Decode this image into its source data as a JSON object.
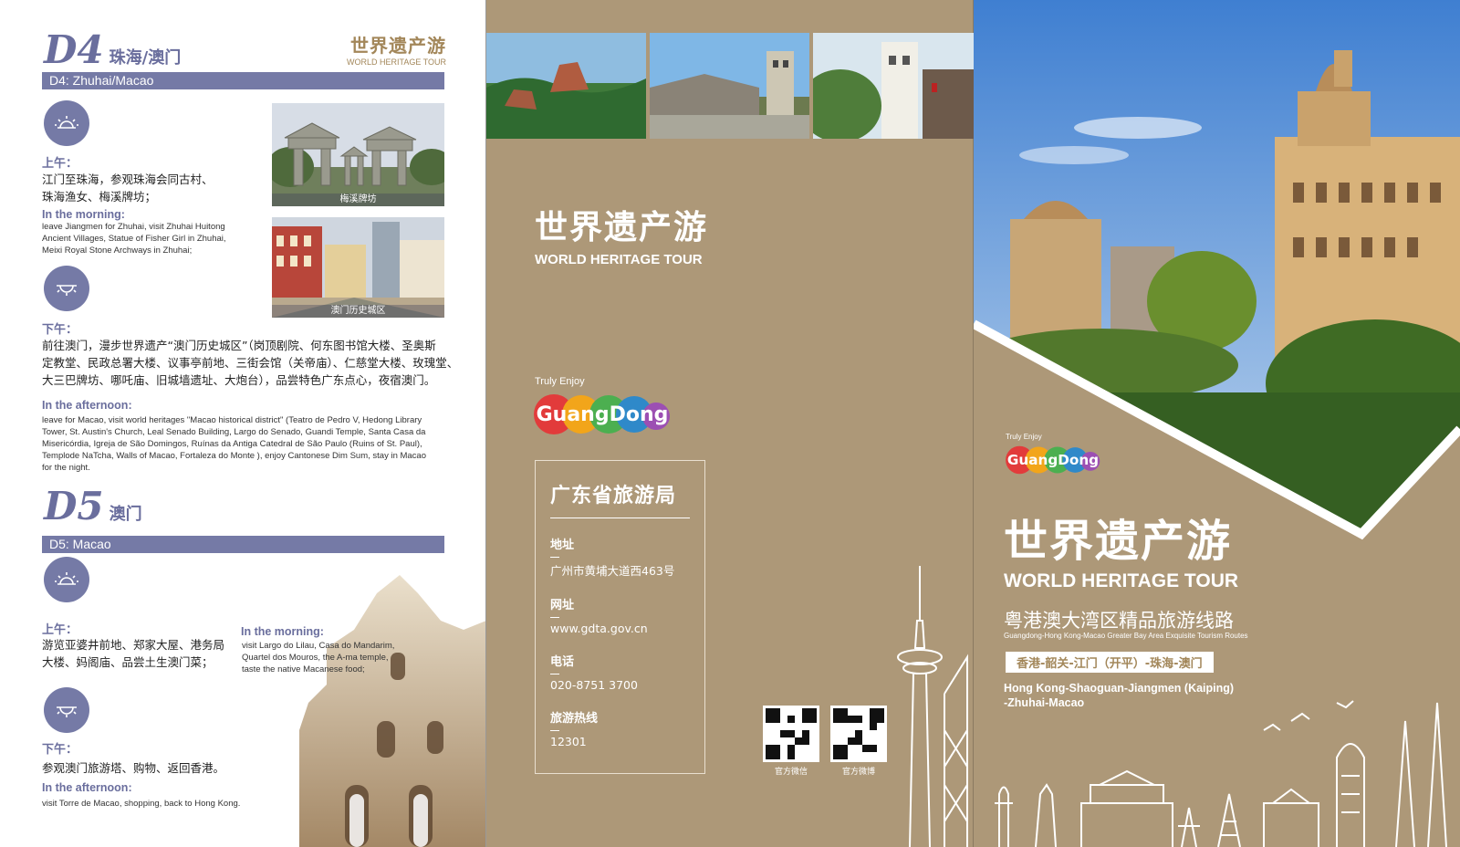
{
  "brand": {
    "cn": "世界遗产游",
    "en": "WORLD HERITAGE TOUR"
  },
  "d4": {
    "num": "D4",
    "city": "珠海/澳门",
    "bar": "D4: Zhuhai/Macao",
    "am_label": "上午：",
    "am_cn": [
      "江门至珠海，参观珠海会同古村、",
      "珠海渔女、梅溪牌坊；"
    ],
    "am_en_title": "In the morning:",
    "am_en": [
      "leave Jiangmen for Zhuhai, visit Zhuhai Huitong",
      "Ancient Villages, Statue of Fisher Girl in Zhuhai,",
      "Meixi Royal Stone Archways in Zhuhai;"
    ],
    "pm_label": "下午：",
    "pm_cn": [
      "前往澳门，漫步世界遗产“澳门历史城区”（岗顶剧院、何东图书馆大楼、圣奥斯",
      "定教堂、民政总署大楼、议事亭前地、三街会馆（关帝庙）、仁慈堂大楼、玫瑰堂、",
      "大三巴牌坊、哪吒庙、旧城墙遗址、大炮台），品尝特色广东点心，夜宿澳门。"
    ],
    "pm_en_title": "In the afternoon:",
    "pm_en": [
      "leave for Macao, visit world heritages \"Macao historical district\" (Teatro de Pedro V, Hedong Library",
      "Tower, St. Austin's Church, Leal Senado Building, Largo do Senado, Guandi Temple, Santa Casa da",
      "Misericórdia, Igreja de São Domingos, Ruínas da Antiga Catedral de São Paulo (Ruins of St. Paul),",
      "Templode NaTcha, Walls of Macao, Fortaleza do Monte ), enjoy Cantonese Dim Sum, stay in Macao",
      "for the night."
    ],
    "photo1_cap": "梅溪牌坊",
    "photo2_cap": "澳门历史城区"
  },
  "d5": {
    "num": "D5",
    "city": "澳门",
    "bar": "D5: Macao",
    "am_label": "上午：",
    "am_cn": [
      "游览亚婆井前地、郑家大屋、港务局",
      "大楼、妈阁庙、品尝土生澳门菜；"
    ],
    "am_en_title": "In the morning:",
    "am_en": [
      "visit Largo do Lilau, Casa do Mandarim,",
      "Quartel dos Mouros, the A-ma temple,",
      "taste the native Macanese food;"
    ],
    "pm_label": "下午：",
    "pm_cn": "参观澳门旅游塔、购物、返回香港。",
    "pm_en_title": "In the afternoon:",
    "pm_en": "visit Torre de Macao, shopping, back to Hong Kong."
  },
  "truly": "Truly Enjoy",
  "logo": "GuangDong",
  "info": {
    "title": "广东省旅游局",
    "address_k": "地址",
    "address_v": "广州市黄埔大道西463号",
    "web_k": "网址",
    "web_v": "www.gdta.gov.cn",
    "tel_k": "电话",
    "tel_v": "020-8751 3700",
    "hot_k": "旅游热线",
    "hot_v": "12301"
  },
  "qr": {
    "wechat": "官方微信",
    "weibo": "官方微博"
  },
  "cover": {
    "sub_cn": "粤港澳大湾区精品旅游线路",
    "sub_en": "Guangdong-Hong Kong-Macao Greater Bay Area Exquisite Tourism Routes",
    "route_cn": "香港-韶关-江门（开平）-珠海-澳门",
    "route_en": [
      "Hong Kong-Shaoguan-Jiangmen (Kaiping)",
      "-Zhuhai-Macao"
    ]
  },
  "colors": {
    "accent": "#757aa6",
    "tan": "#ad9878",
    "gold": "#a3875a"
  }
}
